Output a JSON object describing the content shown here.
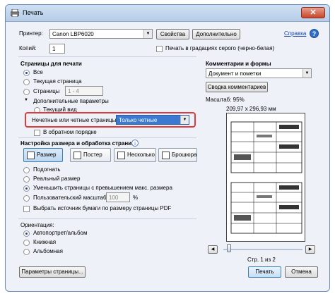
{
  "window": {
    "title": "Печать",
    "close_glyph": "✕"
  },
  "printer": {
    "label": "Принтер:",
    "value": "Canon LBP6020",
    "properties_button": "Свойства",
    "advanced_button": "Дополнительно"
  },
  "help_link": "Справка",
  "copies": {
    "label": "Копий:",
    "value": "1"
  },
  "grayscale": {
    "label": "Печать в градациях серого (черно-белая)"
  },
  "pages": {
    "heading": "Страницы для печати",
    "all": "Все",
    "current": "Текущая страница",
    "range": "Страницы",
    "range_value": "1 - 4",
    "more_options": "Дополнительные параметры",
    "current_view": "Текущий вид",
    "odd_even_label": "Нечетные или четные страницы:",
    "odd_even_value": "Только четные",
    "reverse": "В обратном порядке"
  },
  "sizing": {
    "heading": "Настройка размера и обработка страниц",
    "tabs": [
      "Размер",
      "Постер",
      "Несколько",
      "Брошюра"
    ],
    "fit": "Подогнать",
    "actual": "Реальный размер",
    "shrink": "Уменьшить страницы с превышением макс. размера",
    "custom": "Пользовательский масштаб:",
    "custom_value": "100",
    "percent": "%",
    "paper_source": "Выбрать источник бумаги по размеру страницы PDF"
  },
  "orientation": {
    "heading": "Ориентация:",
    "auto": "Автопортрет/альбом",
    "portrait": "Книжная",
    "landscape": "Альбомная"
  },
  "comments": {
    "heading": "Комментарии и формы",
    "value": "Документ и пометки",
    "summary_button": "Сводка комментариев"
  },
  "scale": {
    "label": "Масштаб: 95%",
    "dimensions": "209,97 x 296,93 мм"
  },
  "nav": {
    "prev": "◀",
    "next": "▶",
    "page_label": "Стр. 1 из 2"
  },
  "footer": {
    "page_setup": "Параметры страницы...",
    "print": "Печать",
    "cancel": "Отмена"
  }
}
